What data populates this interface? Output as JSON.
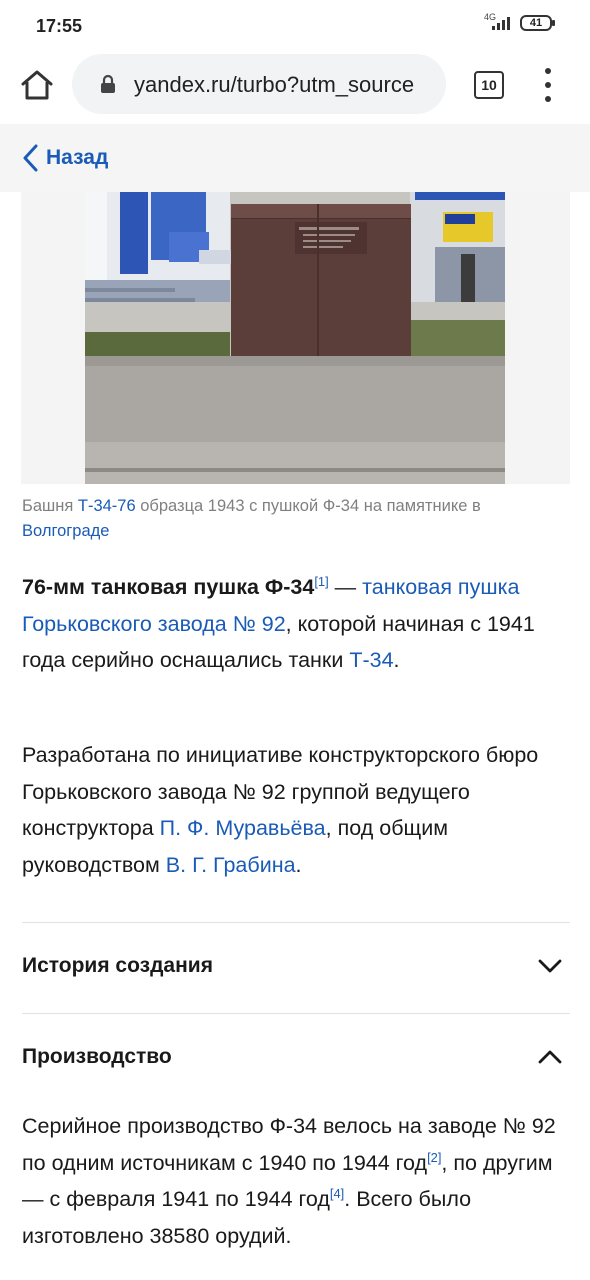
{
  "status_bar": {
    "time": "17:55",
    "network": "4G",
    "battery": "41"
  },
  "browser": {
    "url": "yandex.ru/turbo?utm_source",
    "tab_count": "10"
  },
  "nav": {
    "back_label": "Назад"
  },
  "caption": {
    "t1": "Башня ",
    "link1": "Т-34-76",
    "t2": " образца 1943 с пушкой Ф-34 на памятнике в ",
    "link2": "Волгограде"
  },
  "intro": {
    "bold": "76-мм танковая пушка Ф-34",
    "ref": "[1]",
    "dash": " — ",
    "link1": "танковая пушка Горьковского завода № 92",
    "t1": ", которой начиная с 1941 года серийно оснащались танки ",
    "link2": "Т-34",
    "t2": "."
  },
  "dev": {
    "t1": "Разработана по инициативе конструкторского бюро Горьковского завода № 92 группой ведущего конструктора ",
    "link1": "П. Ф. Муравьёва",
    "t2": ", под общим руководством ",
    "link2": "В. Г. Грабина",
    "t3": "."
  },
  "sections": [
    {
      "title": "История создания",
      "state": "collapsed"
    },
    {
      "title": "Производство",
      "state": "expanded"
    }
  ],
  "production": {
    "t1": "Серийное производство Ф-34 велось на заводе № 92 по одним источникам с 1940 по 1944 год",
    "ref1": "[2]",
    "t2": ", по другим — с февраля 1941 по 1944 год",
    "ref2": "[4]",
    "t3": ". Всего было изготовлено 38580 орудий."
  },
  "colors": {
    "link": "#1a5bb8",
    "nav_bg": "#f5f5f5",
    "url_pill": "#f1f3f4"
  }
}
